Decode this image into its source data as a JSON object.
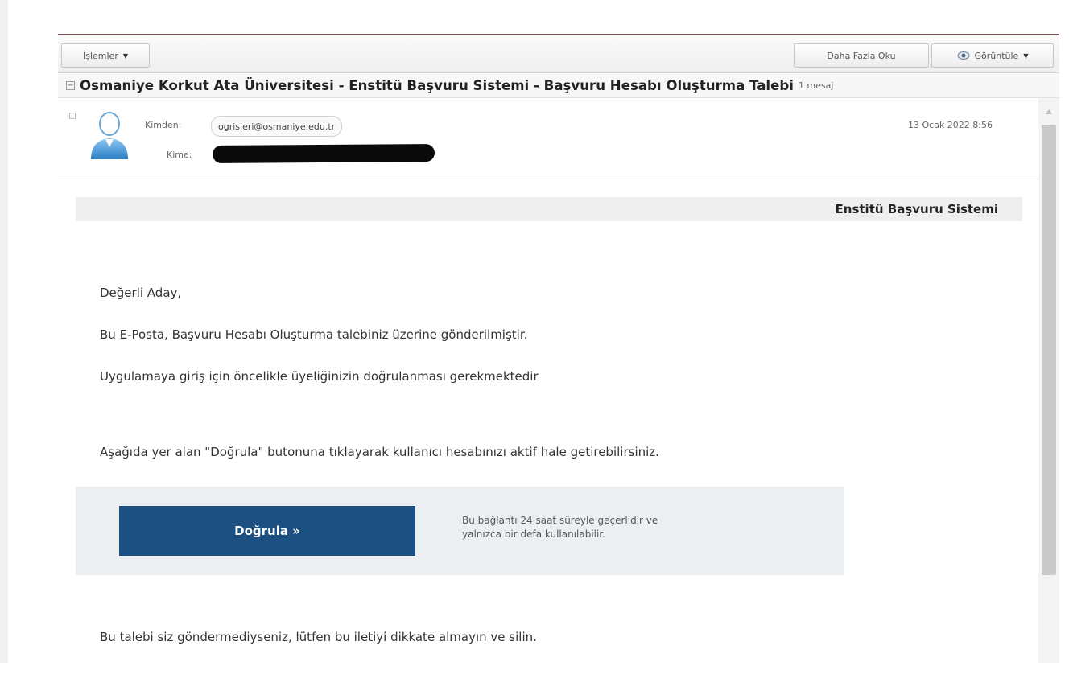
{
  "toolbar": {
    "actions_label": "İşlemler",
    "read_more_label": "Daha Fazla Oku",
    "view_label": "Görüntüle"
  },
  "message_list": {
    "subject": "Osmaniye Korkut Ata Üniversitesi - Enstitü Başvuru Sistemi - Başvuru Hesabı Oluşturma Talebi",
    "count": "1 mesaj"
  },
  "message_header": {
    "from_label": "Kimden:",
    "from_address": "ogrisleri@osmaniye.edu.tr",
    "to_label": "Kime:",
    "date": "13 Ocak 2022 8:56"
  },
  "email_body": {
    "system_title": "Enstitü Başvuru Sistemi",
    "greeting": "Değerli Aday,",
    "line1": "Bu E-Posta, Başvuru Hesabı Oluşturma talebiniz üzerine gönderilmiştir.",
    "line2": "Uygulamaya giriş için öncelikle üyeliğinizin doğrulanması gerekmektedir",
    "line3": "Aşağıda yer alan \"Doğrula\" butonuna tıklayarak kullanıcı hesabınızı aktif hale getirebilirsiniz.",
    "verify_button": "Doğrula »",
    "verify_note_1": "Bu bağlantı 24 saat süreyle geçerlidir ve",
    "verify_note_2": "yalnızca bir defa kullanılabilir.",
    "footer": "Bu talebi siz göndermediyseniz, lütfen bu iletiyi dikkate almayın ve silin."
  },
  "icons": {
    "avatar": "person-avatar-icon",
    "view": "eye-icon",
    "collapse": "collapse-icon"
  },
  "colors": {
    "button_bg": "#1c4f82",
    "verify_box_bg": "#eceff1",
    "top_rule": "#7a5a5a"
  }
}
